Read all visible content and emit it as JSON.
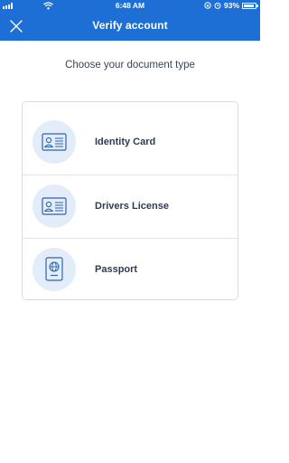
{
  "status_bar": {
    "time": "6:48 AM",
    "battery": "93%",
    "battery_level": 0.93
  },
  "app_bar": {
    "title": "Verify account",
    "close_icon": "close-icon"
  },
  "heading": "Choose your document type",
  "options": [
    {
      "label": "Identity Card",
      "icon": "id-card-icon"
    },
    {
      "label": "Drivers License",
      "icon": "drivers-license-icon"
    },
    {
      "label": "Passport",
      "icon": "passport-icon"
    }
  ],
  "colors": {
    "primary": "#1d6fd6",
    "icon_bg": "#e3edf9",
    "icon_stroke": "#2e63ad",
    "text": "#2f3b4e"
  }
}
